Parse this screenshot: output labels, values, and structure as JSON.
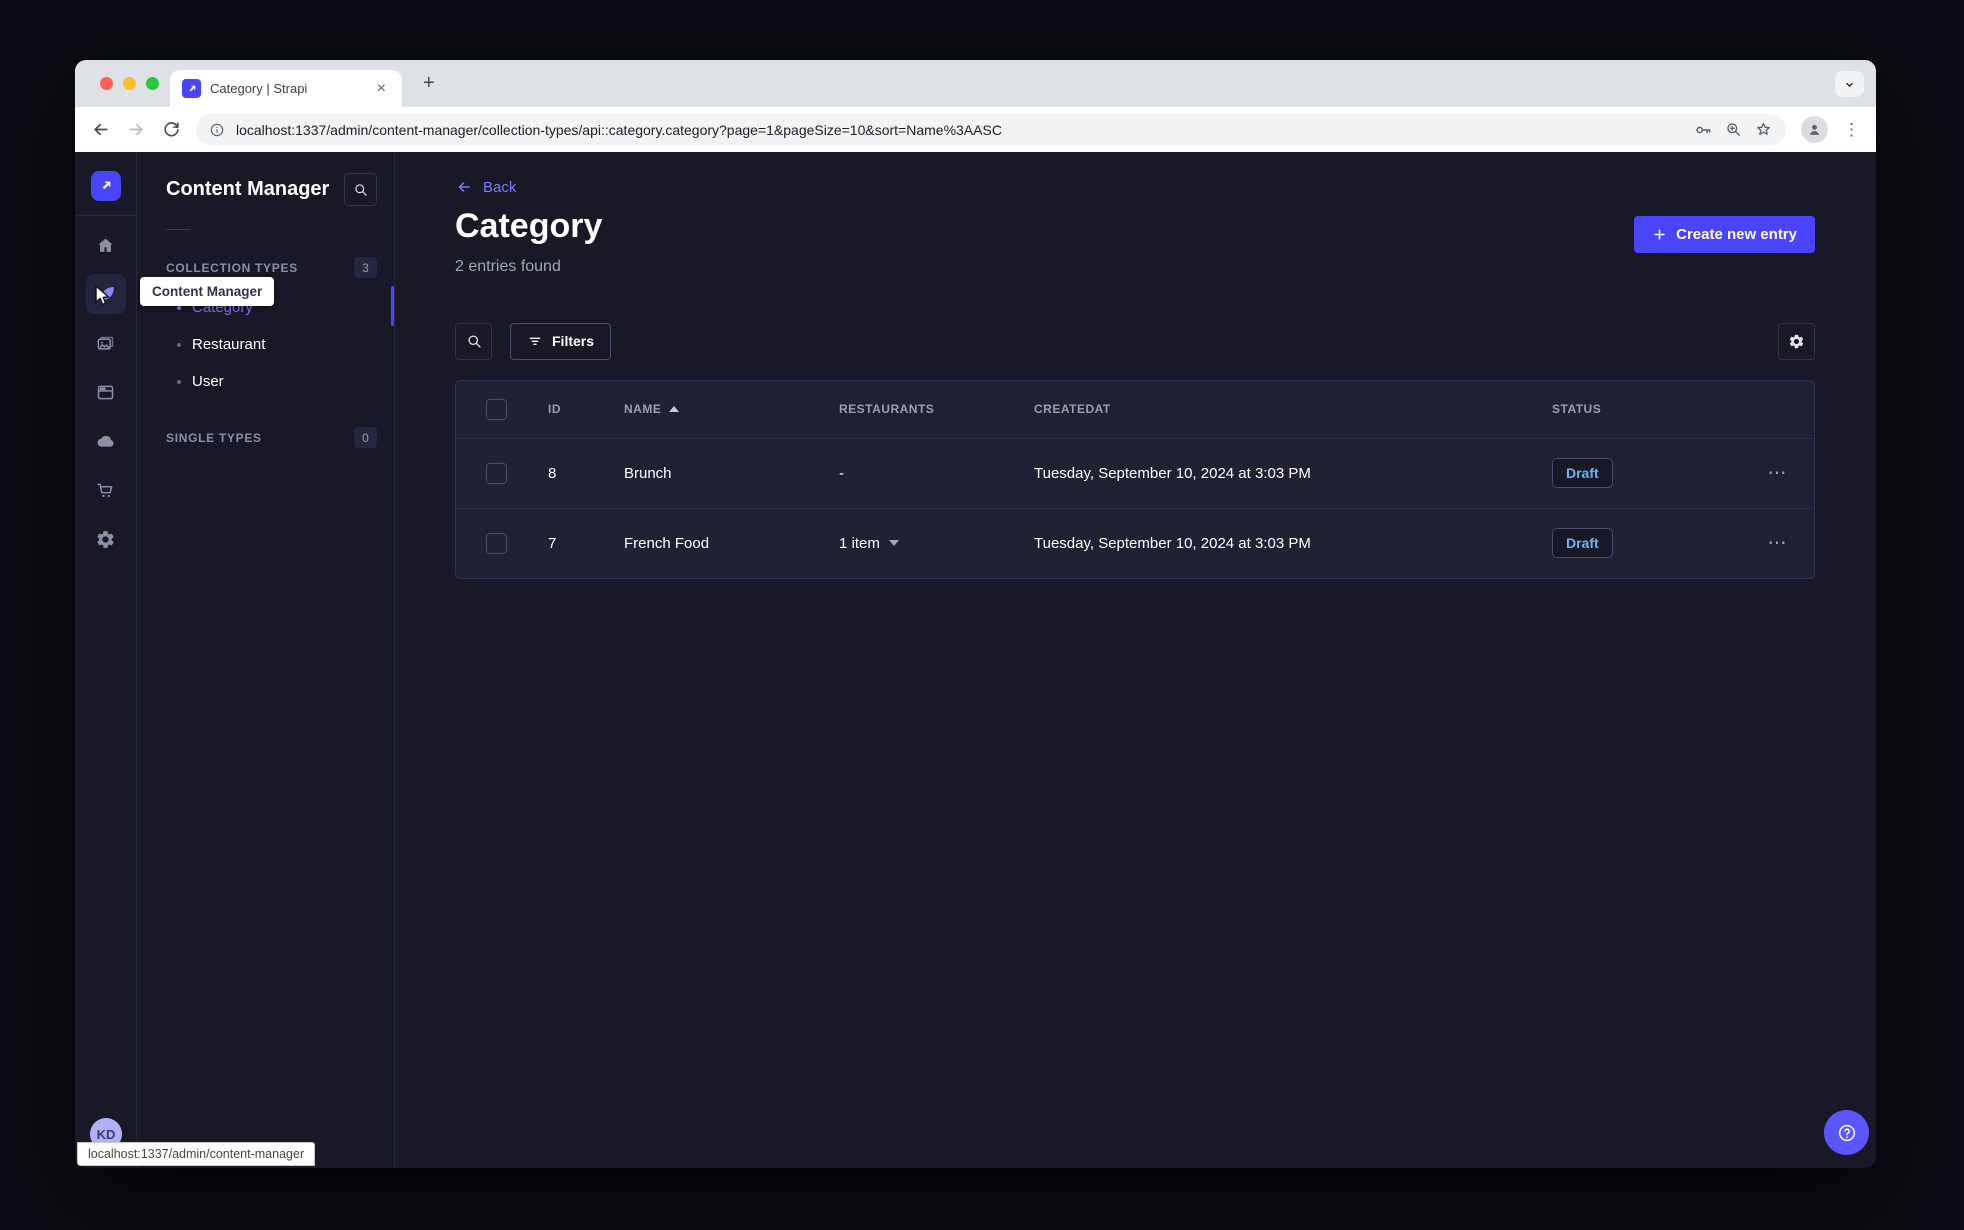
{
  "colors": {
    "primary": "#4945ff",
    "link": "#7b79ff",
    "draft_text": "#66b7f1",
    "page_bg": "#181826",
    "panel_bg": "#212134",
    "border": "#32324d"
  },
  "browser": {
    "tab_title": "Category | Strapi",
    "url": "localhost:1337/admin/content-manager/collection-types/api::category.category?page=1&pageSize=10&sort=Name%3AASC"
  },
  "rail_icons": [
    "strapi-logo",
    "home",
    "content-manager",
    "media-library",
    "content-type-builder",
    "cloud",
    "marketplace",
    "settings"
  ],
  "nav": {
    "title": "Content Manager",
    "collection_types_label": "COLLECTION TYPES",
    "collection_types_count": "3",
    "items": [
      "Category",
      "Restaurant",
      "User"
    ],
    "single_types_label": "SINGLE TYPES",
    "single_types_count": "0"
  },
  "tooltip": {
    "content_manager": "Content Manager"
  },
  "header": {
    "back": "Back",
    "title": "Category",
    "subtitle": "2 entries found",
    "create_button": "Create new entry"
  },
  "filters": {
    "label": "Filters"
  },
  "table": {
    "headers": {
      "id": "ID",
      "name": "NAME",
      "restaurants": "RESTAURANTS",
      "createdat": "CREATEDAT",
      "status": "STATUS"
    },
    "rows": [
      {
        "id": "8",
        "name": "Brunch",
        "restaurants": "-",
        "createdat": "Tuesday, September 10, 2024 at 3:03 PM",
        "status": "Draft"
      },
      {
        "id": "7",
        "name": "French Food",
        "restaurants": "1 item",
        "createdat": "Tuesday, September 10, 2024 at 3:03 PM",
        "status": "Draft"
      }
    ]
  },
  "user": {
    "initials": "KD"
  },
  "status_bar": {
    "text": "localhost:1337/admin/content-manager"
  }
}
